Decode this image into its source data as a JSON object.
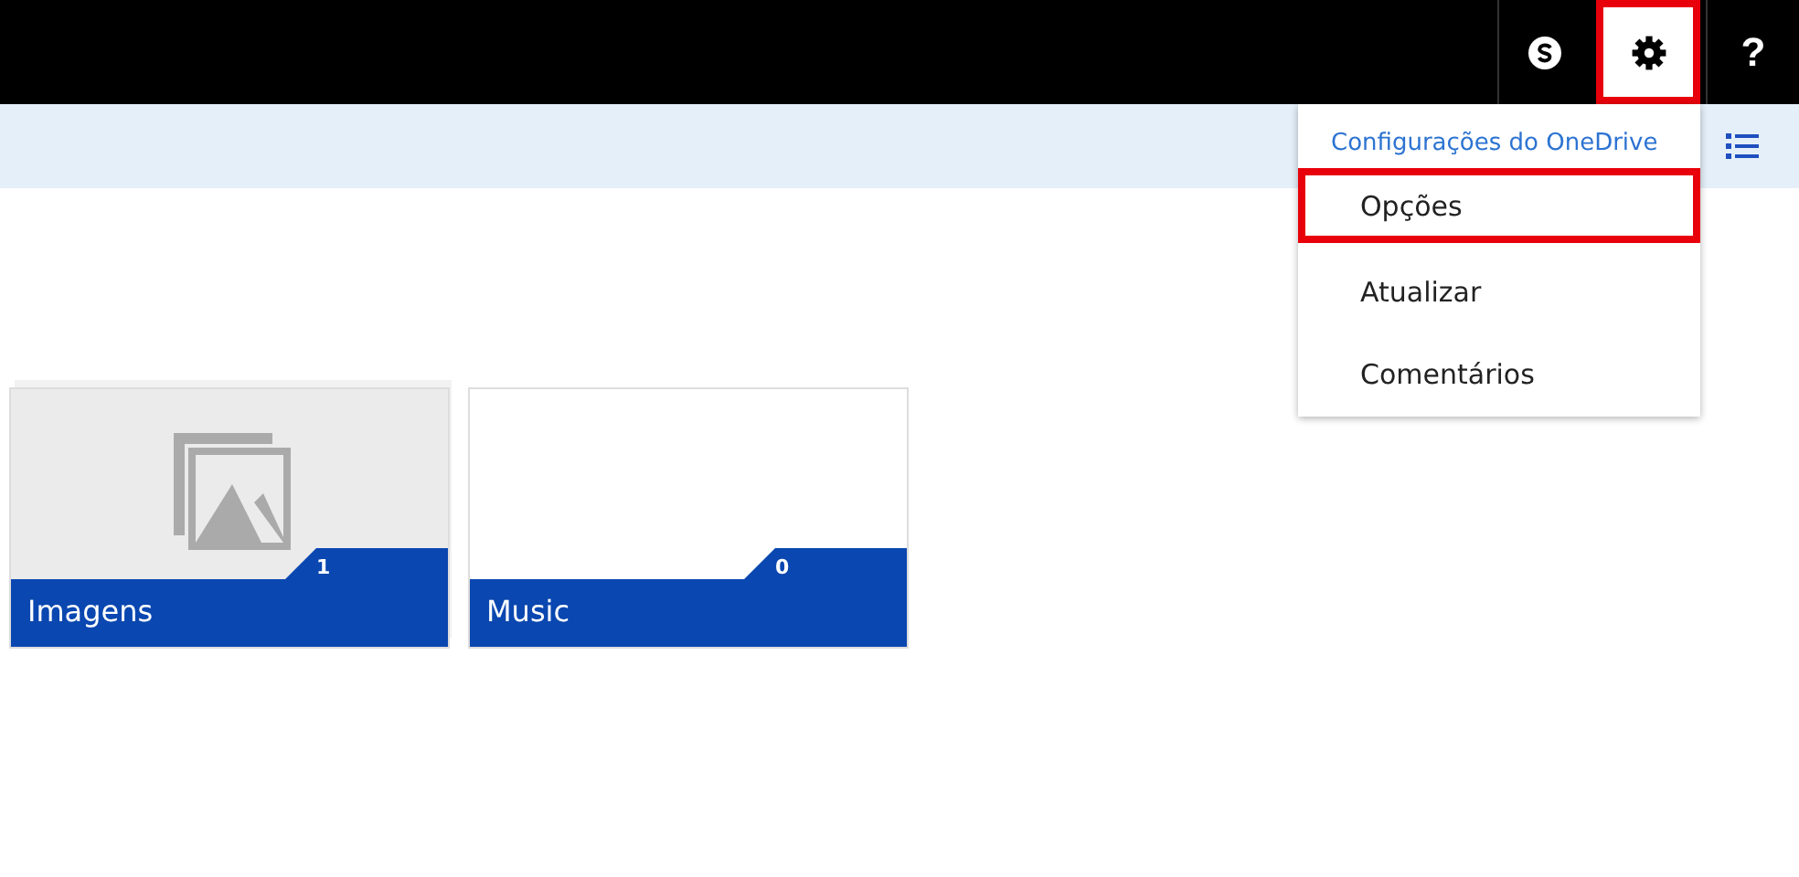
{
  "top_bar": {
    "buttons": [
      {
        "kind": "skype",
        "selected": false,
        "highlighted": false
      },
      {
        "kind": "settings",
        "selected": true,
        "highlighted": true
      },
      {
        "kind": "help",
        "glyph": "?",
        "selected": false,
        "highlighted": false
      }
    ]
  },
  "toolbar": {
    "view_button": {
      "kind": "list"
    }
  },
  "settings_menu": {
    "title": "Configurações do OneDrive",
    "items": [
      {
        "label": "Opções",
        "highlighted": true
      },
      {
        "label": "Atualizar",
        "highlighted": false
      },
      {
        "label": "Comentários",
        "highlighted": false
      }
    ]
  },
  "folders": [
    {
      "name": "Imagens",
      "count": "1",
      "kind": "photos"
    },
    {
      "name": "Music",
      "count": "0",
      "kind": "empty"
    }
  ]
}
